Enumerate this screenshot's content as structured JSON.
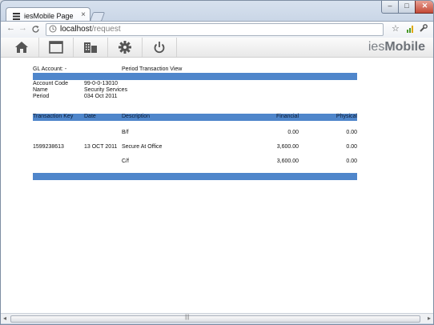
{
  "browser": {
    "tab_title": "iesMobile Page",
    "tab_close": "×",
    "url_host": "localhost",
    "url_path": "/request",
    "back": "←",
    "forward": "→",
    "reload": "C",
    "star": "☆",
    "wrench": "🔧",
    "min": "–",
    "max": "□",
    "close": "✕",
    "colors": {
      "accent": "#4f86cb"
    }
  },
  "app": {
    "brand_light": "ies",
    "brand_bold": "Mobile",
    "toolbar_icons": [
      "home-icon",
      "window-icon",
      "building-icon",
      "gear-icon",
      "power-icon"
    ]
  },
  "report": {
    "gl_account_label": "GL Account: -",
    "view_title": "Period Transaction View",
    "fields": [
      {
        "label": "Account Code",
        "value": "99-0-0-13010"
      },
      {
        "label": "Name",
        "value": "Security Services"
      },
      {
        "label": "Period",
        "value": "034  Oct 2011"
      }
    ],
    "columns": {
      "key": "Transaction Key",
      "date": "Date",
      "desc": "Description",
      "fin": "Financial",
      "phys": "Physical"
    },
    "rows": [
      {
        "key": "",
        "date": "",
        "desc": "B/f",
        "fin": "0.00",
        "phys": "0.00"
      },
      {
        "key": "1599238613",
        "date": "13 OCT 2011",
        "desc": "Secure At Office",
        "fin": "3,600.00",
        "phys": "0.00"
      },
      {
        "key": "",
        "date": "",
        "desc": "C/f",
        "fin": "3,600.00",
        "phys": "0.00"
      }
    ]
  },
  "scrollbar": {
    "left": "◂",
    "right": "▸",
    "grip": "|||"
  }
}
